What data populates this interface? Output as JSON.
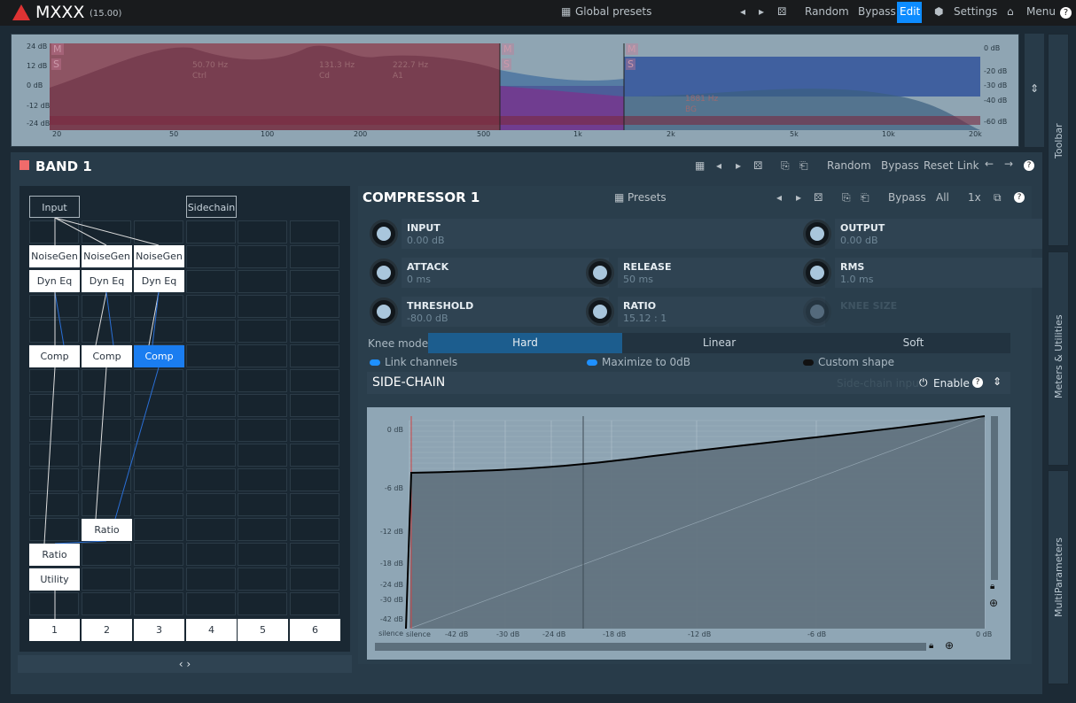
{
  "app": {
    "title": "MXXX",
    "version": "(15.00)"
  },
  "topbar": {
    "global_presets": "Global presets",
    "random": "Random",
    "bypass": "Bypass",
    "edit": "Edit",
    "settings": "Settings",
    "menu": "Menu",
    "help": "?"
  },
  "spectrum": {
    "db_left": [
      "24 dB",
      "12 dB",
      "0 dB",
      "-12 dB",
      "-24 dB"
    ],
    "db_right": [
      "0 dB",
      "-20 dB",
      "-30 dB",
      "-40 dB",
      "-60 dB"
    ],
    "freq": [
      "20",
      "50",
      "100",
      "200",
      "500",
      "1k",
      "2k",
      "5k",
      "10k",
      "20k"
    ],
    "markers": [
      {
        "f": "50.70 Hz",
        "t": "Ctrl"
      },
      {
        "f": "131.3 Hz",
        "t": "Cd"
      },
      {
        "f": "222.7 Hz",
        "t": "A1"
      },
      {
        "f": "1881 Hz",
        "t": "BG"
      }
    ],
    "ms": [
      "M",
      "S"
    ]
  },
  "band": {
    "title": "BAND 1",
    "color": "#f06b6b",
    "random": "Random",
    "bypass": "Bypass",
    "reset": "Reset",
    "link": "Link",
    "help": "?"
  },
  "routing": {
    "input": "Input",
    "sidechain": "Sidechain",
    "noisegen": "NoiseGen",
    "dyneq": "Dyn Eq",
    "comp": "Comp",
    "ratio": "Ratio",
    "utility": "Utility",
    "columns": [
      "1",
      "2",
      "3",
      "4",
      "5",
      "6"
    ],
    "collapse": "‹ ›"
  },
  "compressor": {
    "title": "COMPRESSOR 1",
    "presets": "Presets",
    "bypass": "Bypass",
    "all": "All",
    "zoom": "1x",
    "help": "?",
    "params": {
      "input": {
        "label": "INPUT",
        "value": "0.00 dB"
      },
      "output": {
        "label": "OUTPUT",
        "value": "0.00 dB"
      },
      "attack": {
        "label": "ATTACK",
        "value": "0 ms"
      },
      "release": {
        "label": "RELEASE",
        "value": "50 ms"
      },
      "rms": {
        "label": "RMS",
        "value": "1.0 ms"
      },
      "threshold": {
        "label": "THRESHOLD",
        "value": "-80.0 dB"
      },
      "ratio": {
        "label": "RATIO",
        "value": "15.12 : 1"
      },
      "knee": {
        "label": "KNEE SIZE"
      }
    },
    "knee_mode": {
      "label": "Knee mode",
      "options": [
        "Hard",
        "Linear",
        "Soft"
      ],
      "selected": "Hard"
    },
    "link_channels": "Link channels",
    "maximize": "Maximize to 0dB",
    "custom_shape": "Custom shape",
    "sidechain": {
      "title": "SIDE-CHAIN",
      "input": "Side-chain input",
      "enable": "Enable",
      "help": "?"
    }
  },
  "graph": {
    "y_ticks": [
      "0 dB",
      "-6 dB",
      "-12 dB",
      "-18 dB",
      "-24 dB",
      "-30 dB",
      "-42 dB",
      "silence"
    ],
    "x_ticks": [
      "silence",
      "-42 dB",
      "-30 dB",
      "-24 dB",
      "-18 dB",
      "-12 dB",
      "-6 dB",
      "0 dB"
    ]
  },
  "sidebar": {
    "toolbar": "Toolbar",
    "meters": "Meters & Utilities",
    "multiparams": "MultiParameters"
  }
}
